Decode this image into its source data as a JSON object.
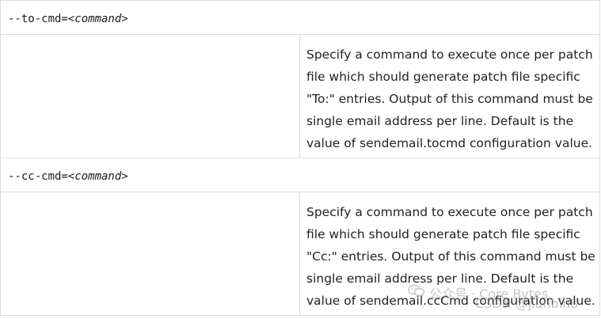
{
  "rows": [
    {
      "option_prefix": "--to-cmd=",
      "option_param": "<command>",
      "description_lines": [
        "Specify a command to execute once per patch",
        "file which should generate patch file specific",
        "\"To:\" entries. Output of this command must be",
        "single email address per line. Default is the",
        "value of sendemail.tocmd configuration value."
      ]
    },
    {
      "option_prefix": "--cc-cmd=",
      "option_param": "<command>",
      "description_lines": [
        "Specify a command to execute once per patch",
        "file which should generate patch file specific",
        "\"Cc:\" entries. Output of this command must be",
        "single email address per line. Default is the",
        "value of sendemail.ccCmd configuration value."
      ]
    }
  ],
  "watermark": {
    "icon": "wechat-icon",
    "line1": "公众号 · Core Bytes",
    "line2": "CSDN @jianbin8"
  }
}
